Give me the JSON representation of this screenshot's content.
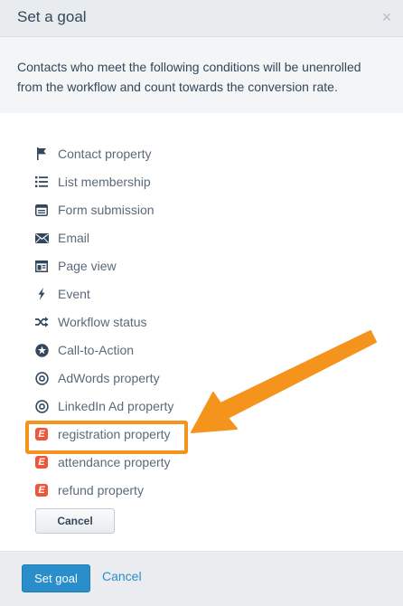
{
  "header": {
    "title": "Set a goal",
    "close_glyph": "×"
  },
  "description": "Contacts who meet the following conditions will be unenrolled from the workflow and count towards the conversion rate.",
  "options": [
    {
      "label": "Contact property",
      "icon": "flag-icon"
    },
    {
      "label": "List membership",
      "icon": "list-icon"
    },
    {
      "label": "Form submission",
      "icon": "form-icon"
    },
    {
      "label": "Email",
      "icon": "envelope-icon"
    },
    {
      "label": "Page view",
      "icon": "page-icon"
    },
    {
      "label": "Event",
      "icon": "lightning-icon"
    },
    {
      "label": "Workflow status",
      "icon": "shuffle-icon"
    },
    {
      "label": "Call-to-Action",
      "icon": "star-circle-icon"
    },
    {
      "label": "AdWords property",
      "icon": "target-icon"
    },
    {
      "label": "LinkedIn Ad property",
      "icon": "target-icon"
    },
    {
      "label": "registration property",
      "icon": "eventbrite-icon",
      "highlighted": true
    },
    {
      "label": "attendance property",
      "icon": "eventbrite-icon"
    },
    {
      "label": "refund property",
      "icon": "eventbrite-icon"
    }
  ],
  "eventbrite_glyph": "E",
  "inner_cancel_label": "Cancel",
  "footer": {
    "primary_label": "Set goal",
    "secondary_label": "Cancel"
  },
  "colors": {
    "primary": "#2a8ecb",
    "highlight": "#f5941d",
    "eventbrite": "#f05537"
  }
}
